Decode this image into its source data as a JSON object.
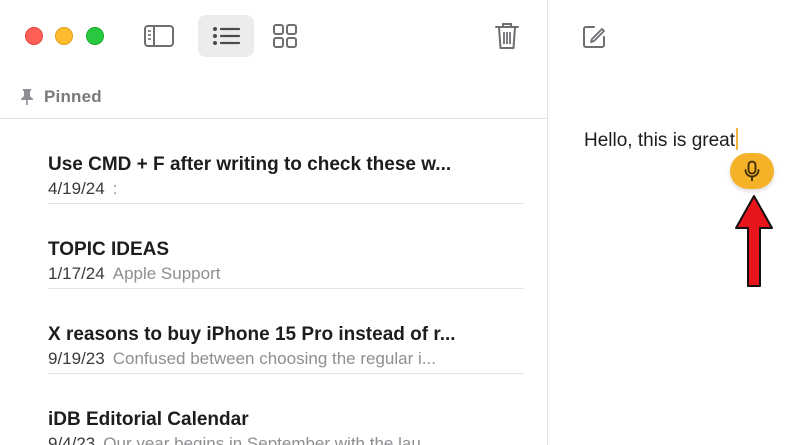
{
  "toolbar": {
    "window_controls": [
      "close",
      "minimize",
      "zoom"
    ],
    "buttons": [
      {
        "icon": "sidebar-icon"
      },
      {
        "icon": "list-view-icon",
        "selected": true
      },
      {
        "icon": "gallery-view-icon"
      },
      {
        "icon": "trash-icon"
      }
    ]
  },
  "section": {
    "icon": "pin-icon",
    "label": "Pinned"
  },
  "notes": [
    {
      "title": "Use CMD + F after writing to check these w...",
      "date": "4/19/24",
      "preview": ":"
    },
    {
      "title": "TOPIC IDEAS",
      "date": "1/17/24",
      "preview": "Apple Support"
    },
    {
      "title": "X reasons to buy iPhone 15 Pro instead of r...",
      "date": "9/19/23",
      "preview": "Confused between choosing the regular i..."
    },
    {
      "title": "iDB Editorial Calendar",
      "date": "9/4/23",
      "preview": "Our year begins in September with the lau..."
    }
  ],
  "editor": {
    "compose_icon": "compose-icon",
    "text": "Hello, this is great",
    "dictation_icon": "microphone-icon",
    "annotation_icon": "red-arrow-icon"
  },
  "colors": {
    "close": "#fe5f57",
    "minimize": "#febc2e",
    "zoom": "#28c840",
    "accent": "#f5b228",
    "arrow": "#e8141b",
    "selected_button_bg": "#ececec"
  }
}
